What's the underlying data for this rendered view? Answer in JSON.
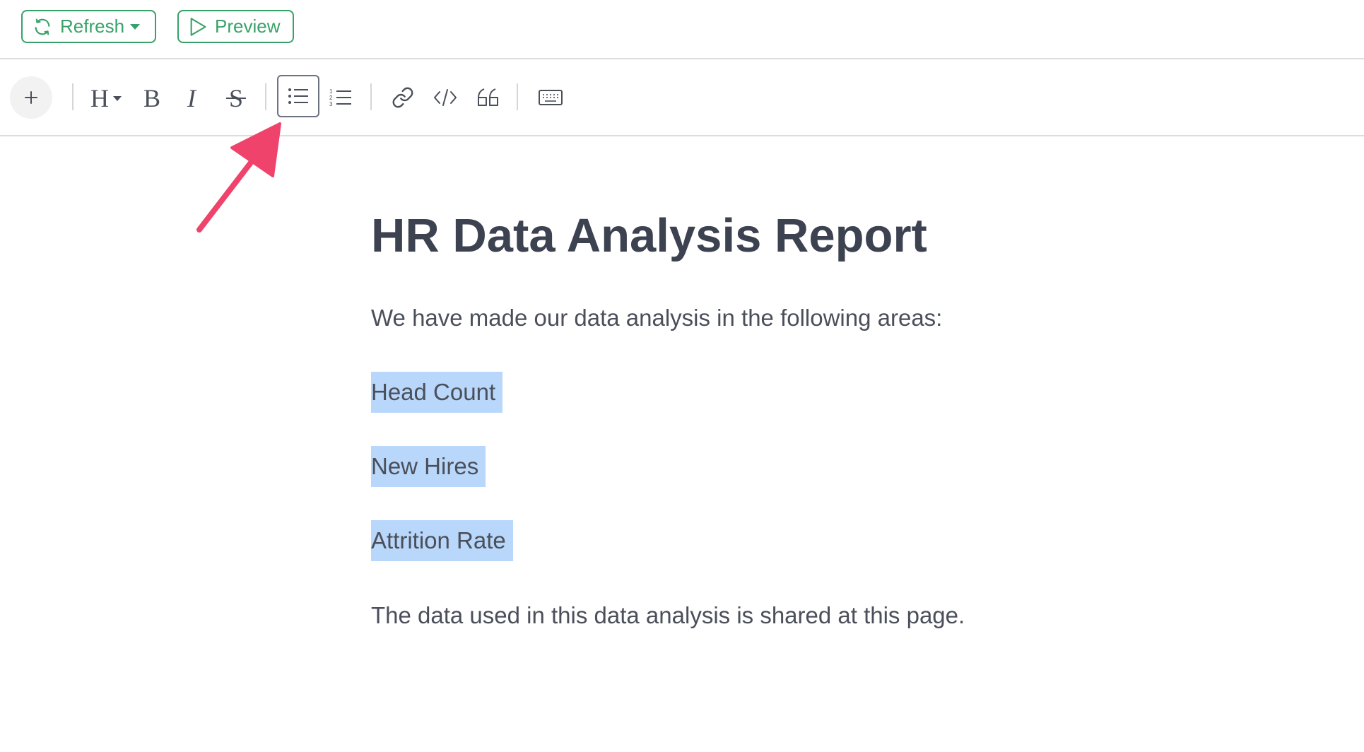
{
  "topbar": {
    "refresh_label": "Refresh",
    "preview_label": "Preview",
    "accent_color": "#38a169"
  },
  "toolbar": {
    "buttons": [
      {
        "name": "add",
        "icon": "plus-icon"
      },
      {
        "name": "heading",
        "icon": "heading-icon",
        "glyph": "H"
      },
      {
        "name": "bold",
        "icon": "bold-icon",
        "glyph": "B"
      },
      {
        "name": "italic",
        "icon": "italic-icon",
        "glyph": "I"
      },
      {
        "name": "strikethrough",
        "icon": "strikethrough-icon",
        "glyph": "S"
      },
      {
        "name": "bulleted-list",
        "icon": "bullet-list-icon",
        "active": true
      },
      {
        "name": "numbered-list",
        "icon": "numbered-list-icon"
      },
      {
        "name": "link",
        "icon": "link-icon"
      },
      {
        "name": "code",
        "icon": "code-icon"
      },
      {
        "name": "quote",
        "icon": "quote-icon"
      },
      {
        "name": "keyboard-shortcuts",
        "icon": "keyboard-icon"
      }
    ]
  },
  "annotation": {
    "icon": "annotation-arrow-icon",
    "color": "#f0436c"
  },
  "document": {
    "title": "HR Data Analysis Report",
    "intro": "We have made our data analysis in the following areas:",
    "selected_items": [
      "Head Count",
      "New Hires",
      "Attrition Rate"
    ],
    "outro": "The data used in this data analysis is shared at this page.",
    "selection_color": "#b8d7fa"
  }
}
